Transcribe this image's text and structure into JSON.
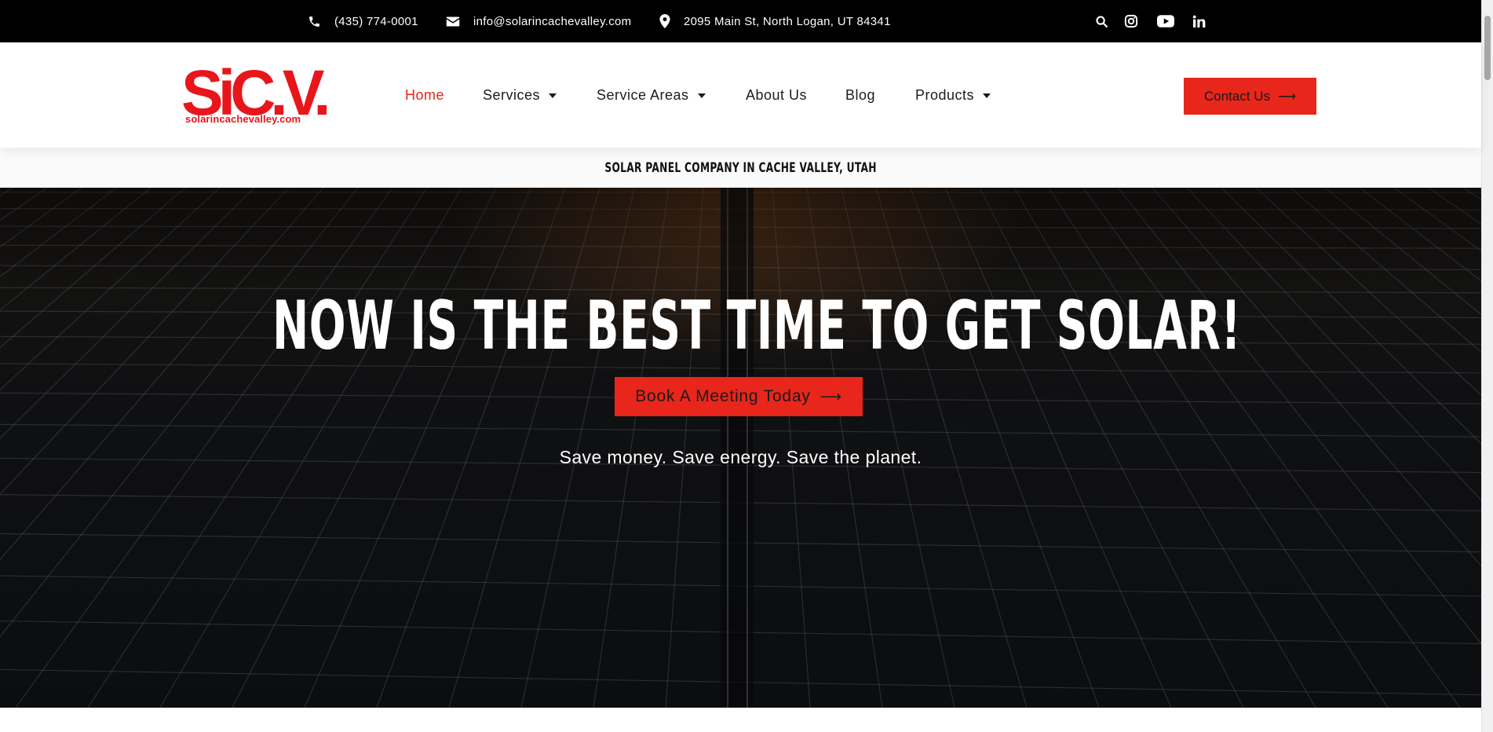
{
  "topbar": {
    "phone": "(435) 774-0001",
    "email": "info@solarincachevalley.com",
    "address": "2095 Main St, North Logan, UT 84341",
    "icons": [
      "search-icon",
      "instagram-icon",
      "youtube-icon",
      "linkedin-icon"
    ]
  },
  "header": {
    "logo_mark": "SICV",
    "logo_url": "solarincachevalley.com",
    "nav": [
      {
        "label": "Home",
        "active": true,
        "dropdown": false
      },
      {
        "label": "Services",
        "active": false,
        "dropdown": true
      },
      {
        "label": "Service Areas",
        "active": false,
        "dropdown": true
      },
      {
        "label": "About Us",
        "active": false,
        "dropdown": false
      },
      {
        "label": "Blog",
        "active": false,
        "dropdown": false
      },
      {
        "label": "Products",
        "active": false,
        "dropdown": true
      }
    ],
    "contact_label": "Contact Us"
  },
  "tagline": "SOLAR PANEL COMPANY IN CACHE VALLEY, UTAH",
  "hero": {
    "title": "NOW IS THE BEST TIME TO GET SOLAR!",
    "cta_label": "Book A Meeting Today",
    "subtitle": "Save money. Save energy. Save the planet."
  },
  "colors": {
    "accent": "#e8261b",
    "logo": "#e8161b",
    "topbar_bg": "#000000"
  }
}
